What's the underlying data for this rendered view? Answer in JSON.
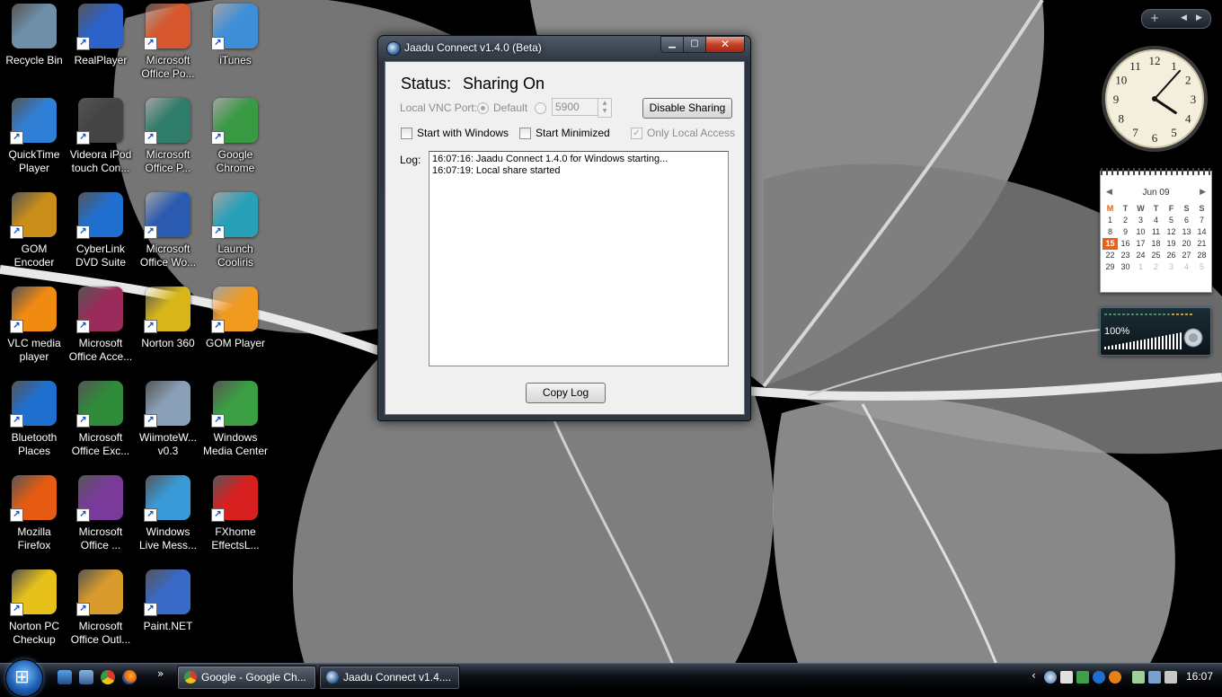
{
  "desktop": {
    "icons": [
      {
        "label": "Recycle Bin",
        "icon": "recycle-bin-icon",
        "color": "#6f8fa8"
      },
      {
        "label": "RealPlayer",
        "icon": "realplayer-icon",
        "color": "#2d63c8"
      },
      {
        "label": "Microsoft\nOffice Po...",
        "icon": "powerpoint-icon",
        "color": "#d8562c"
      },
      {
        "label": "iTunes",
        "icon": "itunes-icon",
        "color": "#3f8fd8"
      },
      {
        "label": "QuickTime\nPlayer",
        "icon": "quicktime-icon",
        "color": "#2f7fd6"
      },
      {
        "label": "Videora iPod\ntouch Con...",
        "icon": "videora-icon",
        "color": "#444444"
      },
      {
        "label": "Microsoft\nOffice P...",
        "icon": "publisher-icon",
        "color": "#2f7c6a"
      },
      {
        "label": "Google\nChrome",
        "icon": "chrome-icon",
        "color": "#3a9a44"
      },
      {
        "label": "GOM\nEncoder",
        "icon": "gom-encoder-icon",
        "color": "#c98f1a"
      },
      {
        "label": "CyberLink\nDVD Suite",
        "icon": "cyberlink-icon",
        "color": "#1f6fd0"
      },
      {
        "label": "Microsoft\nOffice Wo...",
        "icon": "word-icon",
        "color": "#2a5bb0"
      },
      {
        "label": "Launch\nCooliris",
        "icon": "cooliris-icon",
        "color": "#27a0b8"
      },
      {
        "label": "VLC media\nplayer",
        "icon": "vlc-icon",
        "color": "#f08a10"
      },
      {
        "label": "Microsoft\nOffice Acce...",
        "icon": "access-icon",
        "color": "#9a2b5a"
      },
      {
        "label": "Norton 360",
        "icon": "norton360-icon",
        "color": "#d8b51a"
      },
      {
        "label": "GOM Player",
        "icon": "gom-player-icon",
        "color": "#f09a20"
      },
      {
        "label": "Bluetooth\nPlaces",
        "icon": "bluetooth-icon",
        "color": "#1f6fd0"
      },
      {
        "label": "Microsoft\nOffice Exc...",
        "icon": "excel-icon",
        "color": "#2f8a3a"
      },
      {
        "label": "WiimoteW...\nv0.3",
        "icon": "wiimote-icon",
        "color": "#8aa0b8"
      },
      {
        "label": "Windows\nMedia Center",
        "icon": "media-center-icon",
        "color": "#3aa043"
      },
      {
        "label": "Mozilla\nFirefox",
        "icon": "firefox-icon",
        "color": "#e55b13"
      },
      {
        "label": "Microsoft\nOffice ...",
        "icon": "onenote-icon",
        "color": "#7a3a9a"
      },
      {
        "label": "Windows\nLive Mess...",
        "icon": "messenger-icon",
        "color": "#3a9ad8"
      },
      {
        "label": "FXhome\nEffectsL...",
        "icon": "fxhome-icon",
        "color": "#d82020"
      },
      {
        "label": "Norton PC\nCheckup",
        "icon": "norton-checkup-icon",
        "color": "#e8c01a"
      },
      {
        "label": "Microsoft\nOffice Outl...",
        "icon": "outlook-icon",
        "color": "#d89a2a"
      },
      {
        "label": "Paint.NET",
        "icon": "paintnet-icon",
        "color": "#3a6ac8"
      }
    ]
  },
  "window": {
    "title": "Jaadu Connect v1.4.0 (Beta)",
    "min_glyph": "▁",
    "max_glyph": "▢",
    "close_glyph": "✕",
    "status_label": "Status:",
    "status_value": "Sharing On",
    "vnc_port_label": "Local VNC Port:",
    "default_label": "Default",
    "port_value": "5900",
    "disable_button": "Disable Sharing",
    "start_with_windows": "Start with Windows",
    "start_minimized": "Start Minimized",
    "only_local_access": "Only Local Access",
    "log_label": "Log:",
    "log_lines": [
      "16:07:16: Jaadu Connect 1.4.0 for Windows starting...",
      "16:07:19: Local share started"
    ],
    "copy_log_button": "Copy Log"
  },
  "gadgets": {
    "calendar": {
      "header": "Jun 09",
      "prev_glyph": "◀",
      "next_glyph": "▶",
      "days_of_week": [
        "M",
        "T",
        "W",
        "T",
        "F",
        "S",
        "S"
      ],
      "weeks": [
        [
          "1",
          "2",
          "3",
          "4",
          "5",
          "6",
          "7"
        ],
        [
          "8",
          "9",
          "10",
          "11",
          "12",
          "13",
          "14"
        ],
        [
          "15",
          "16",
          "17",
          "18",
          "19",
          "20",
          "21"
        ],
        [
          "22",
          "23",
          "24",
          "25",
          "26",
          "27",
          "28"
        ],
        [
          "29",
          "30",
          "1",
          "2",
          "3",
          "4",
          "5"
        ]
      ],
      "today": "15"
    },
    "volume": {
      "level": "100%"
    },
    "clock_hour": 4,
    "clock_minute": 7
  },
  "taskbar": {
    "more_glyph": "»",
    "tasks": [
      {
        "label": "Google - Google Ch..."
      },
      {
        "label": "Jaadu Connect v1.4...."
      }
    ],
    "tray_arrow": "‹",
    "clock": "16:07"
  },
  "colors": {
    "accent": "#1d5fb3",
    "today_highlight": "#e8601a",
    "close_button": "#c3412a"
  }
}
